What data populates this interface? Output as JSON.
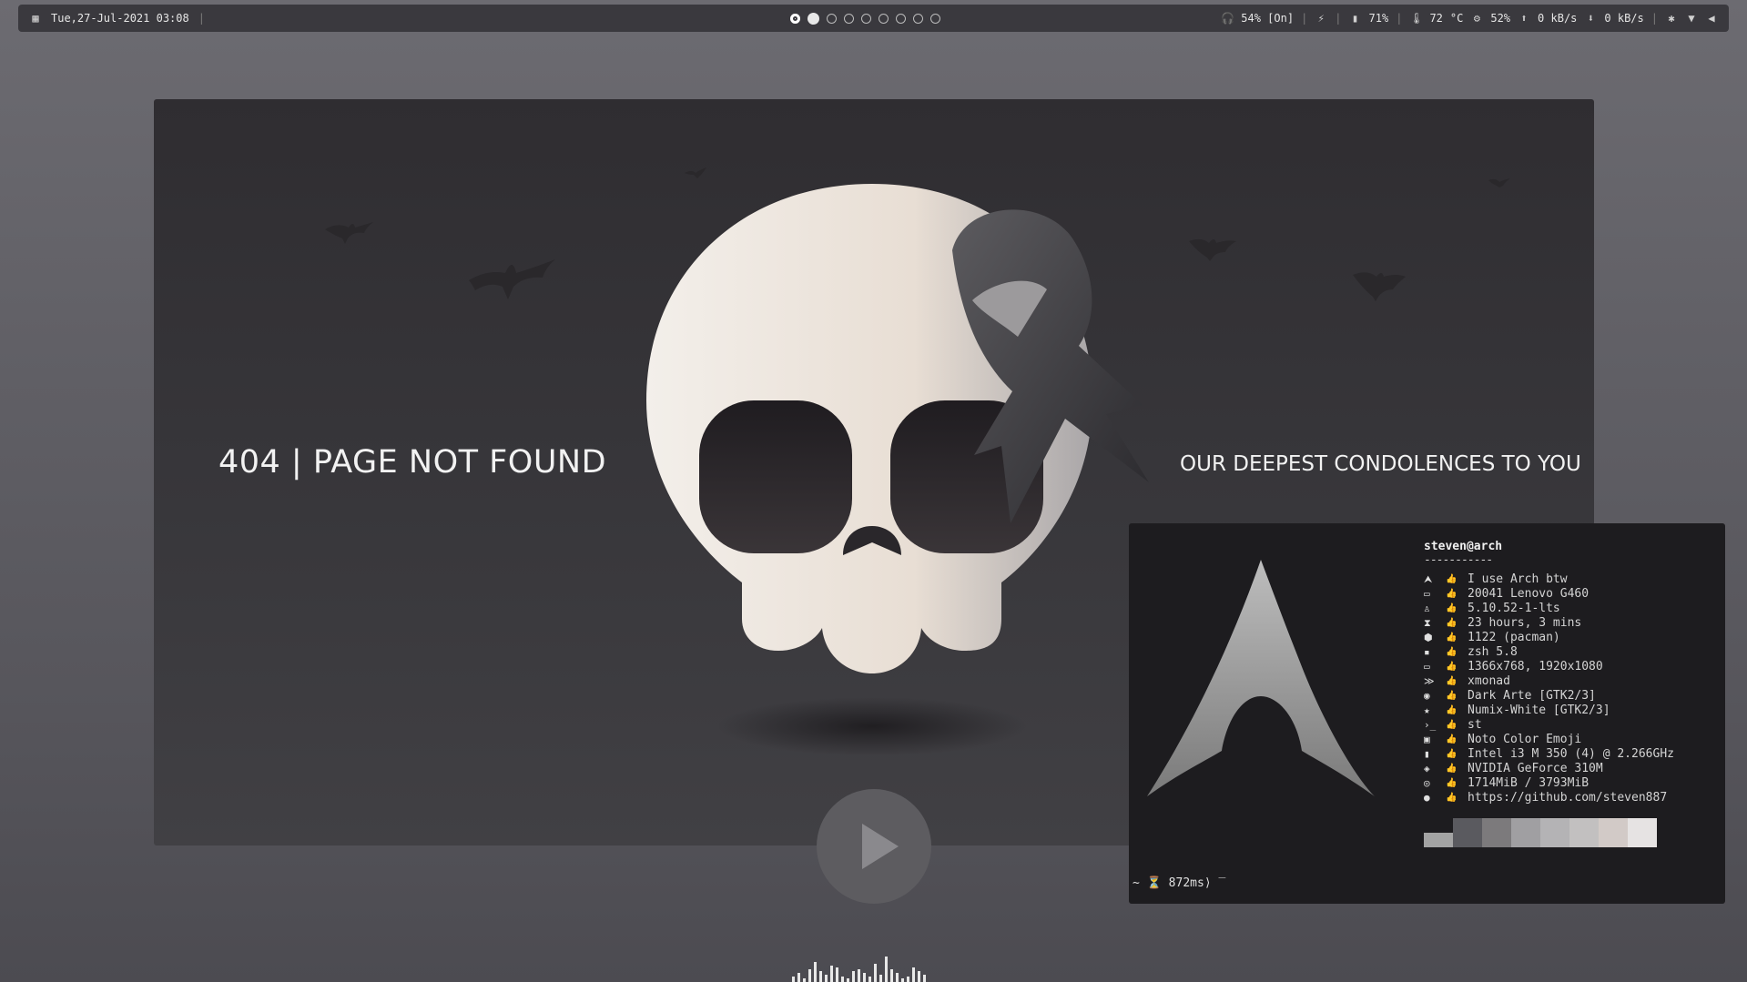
{
  "topbar": {
    "datetime": "Tue,27-Jul-2021 03:08",
    "sep": "|",
    "workspaces": [
      "focus",
      "active",
      "dot",
      "dot",
      "dot",
      "dot",
      "dot",
      "dot",
      "dot"
    ],
    "volume": "54% [On]",
    "battery": "71%",
    "temp": "72",
    "temp_unit": "°C",
    "cpu": "52%",
    "upload": "0 kB/s",
    "download": "0 kB/s"
  },
  "card": {
    "left_text": "404 | PAGE NOT FOUND",
    "right_text": "OUR DEEPEST CONDOLENCES TO YOU"
  },
  "terminal": {
    "user": "steven@arch",
    "dashes": "-----------",
    "info": [
      {
        "icon": "arch-icon",
        "glyph": "⮝",
        "value": "I use Arch btw"
      },
      {
        "icon": "laptop-icon",
        "glyph": "▭",
        "value": "20041 Lenovo G460"
      },
      {
        "icon": "tux-icon",
        "glyph": "♙",
        "value": "5.10.52-1-lts"
      },
      {
        "icon": "hourglass-icon",
        "glyph": "⧗",
        "value": "23 hours, 3 mins"
      },
      {
        "icon": "package-icon",
        "glyph": "⬢",
        "value": "1122 (pacman)"
      },
      {
        "icon": "shell-icon",
        "glyph": "▪",
        "value": "zsh 5.8"
      },
      {
        "icon": "monitor-icon",
        "glyph": "▭",
        "value": "1366x768, 1920x1080"
      },
      {
        "icon": "wm-icon",
        "glyph": "≫",
        "value": "xmonad"
      },
      {
        "icon": "palette-icon",
        "glyph": "◉",
        "value": "Dark Arte [GTK2/3]"
      },
      {
        "icon": "star-icon",
        "glyph": "★",
        "value": "Numix-White [GTK2/3]"
      },
      {
        "icon": "terminal-icon",
        "glyph": "›_",
        "value": "st"
      },
      {
        "icon": "font-icon",
        "glyph": "▣",
        "value": "Noto Color Emoji"
      },
      {
        "icon": "cpu-icon",
        "glyph": "▮",
        "value": "Intel i3 M 350 (4) @ 2.266GHz"
      },
      {
        "icon": "gpu-icon",
        "glyph": "◈",
        "value": "NVIDIA GeForce 310M"
      },
      {
        "icon": "memory-icon",
        "glyph": "◎",
        "value": "1714MiB / 3793MiB"
      },
      {
        "icon": "github-icon",
        "glyph": "●",
        "value": "https://github.com/steven887"
      }
    ],
    "palette": [
      "#a3a3a3",
      "#5a5a5f",
      "#7c7a7c",
      "#a09fa2",
      "#b4b3b5",
      "#c2c0c0",
      "#d2cac7",
      "#e6e3e3"
    ],
    "prompt": "~ ⏳ 872ms⟩ ‾"
  },
  "colors": {
    "bg": "#616066",
    "card": "#333236",
    "skull_light": "#ede6df",
    "skull_dark": "#2a272b",
    "ribbon": "#4a4a4e"
  }
}
